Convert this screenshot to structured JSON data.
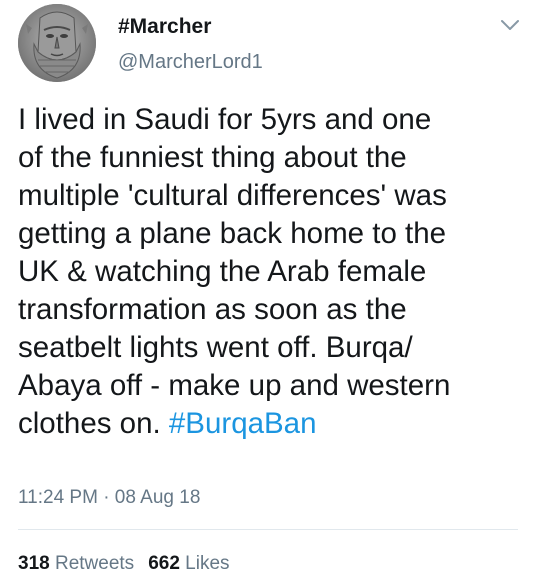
{
  "user": {
    "display_name": "#Marcher",
    "handle": "@MarcherLord1",
    "avatar_icon": "stone-effigy-avatar"
  },
  "menu": {
    "icon": "chevron-down-icon"
  },
  "tweet": {
    "text_before_hashtag": "I lived in Saudi for 5yrs and one\nof the funniest thing about the\nmultiple 'cultural differences' was\ngetting a plane back home to the\nUK & watching the Arab female\ntransformation as soon as the\nseatbelt lights went off. Burqa/\nAbaya off - make up and western\nclothes on. ",
    "hashtag": "#BurqaBan",
    "timestamp": "11:24 PM · 08 Aug 18"
  },
  "stats": {
    "retweets_count": "318",
    "retweets_label": "Retweets",
    "likes_count": "662",
    "likes_label": "Likes"
  },
  "colors": {
    "text": "#14171a",
    "secondary": "#657786",
    "link": "#1b95e0",
    "divider": "#e1e8ed"
  }
}
